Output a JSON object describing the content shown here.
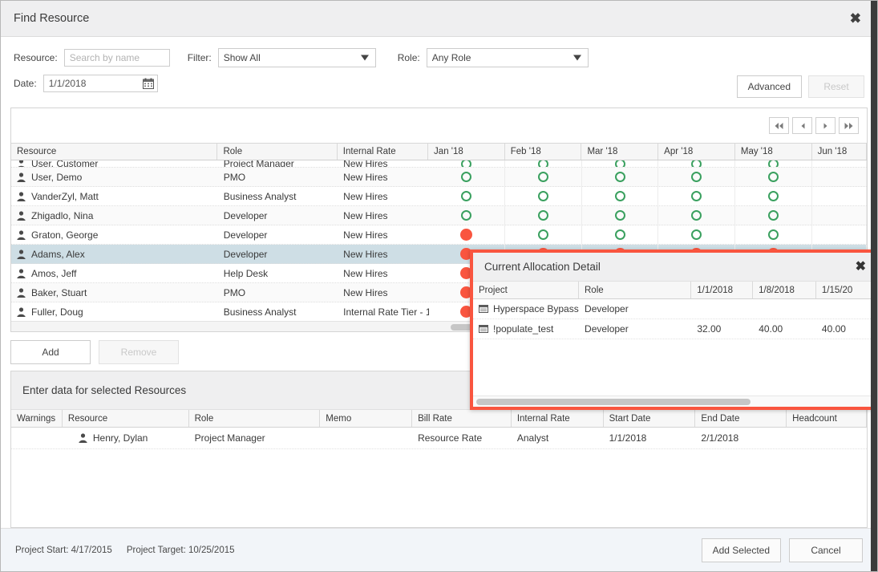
{
  "window": {
    "title": "Find Resource",
    "close_label": "✖"
  },
  "filters": {
    "resource_label": "Resource:",
    "resource_value": "",
    "resource_placeholder": "Search by name",
    "filter_label": "Filter:",
    "filter_value": "Show All",
    "role_label": "Role:",
    "role_value": "Any Role",
    "date_label": "Date:",
    "date_value": "1/1/2018",
    "calendar_icon": "calendar-icon",
    "advanced_label": "Advanced",
    "reset_label": "Reset"
  },
  "grid": {
    "nav": [
      {
        "name": "first-page",
        "glyph": "◀◀"
      },
      {
        "name": "prev-page",
        "glyph": "◀"
      },
      {
        "name": "next-page",
        "glyph": "▶"
      },
      {
        "name": "last-page",
        "glyph": "▶▶"
      }
    ],
    "columns": [
      "Resource",
      "Role",
      "Internal Rate"
    ],
    "month_columns": [
      "Jan '18",
      "Feb '18",
      "Mar '18",
      "Apr '18",
      "May '18",
      "Jun '18"
    ],
    "rows": [
      {
        "resource": "User, Customer",
        "role": "Project Manager",
        "rate": "New Hires",
        "marks": [
          "open",
          "open",
          "open",
          "open",
          "open"
        ],
        "clipped": true,
        "selected": false
      },
      {
        "resource": "User, Demo",
        "role": "PMO",
        "rate": "New Hires",
        "marks": [
          "open",
          "open",
          "open",
          "open",
          "open"
        ],
        "clipped": false,
        "selected": false
      },
      {
        "resource": "VanderZyl, Matt",
        "role": "Business Analyst",
        "rate": "New Hires",
        "marks": [
          "open",
          "open",
          "open",
          "open",
          "open"
        ],
        "clipped": false,
        "selected": false
      },
      {
        "resource": "Zhigadlo, Nina",
        "role": "Developer",
        "rate": "New Hires",
        "marks": [
          "open",
          "open",
          "open",
          "open",
          "open"
        ],
        "clipped": false,
        "selected": false
      },
      {
        "resource": "Graton, George",
        "role": "Developer",
        "rate": "New Hires",
        "marks": [
          "full",
          "open",
          "open",
          "open",
          "open"
        ],
        "clipped": false,
        "selected": false
      },
      {
        "resource": "Adams, Alex",
        "role": "Developer",
        "rate": "New Hires",
        "marks": [
          "full",
          "full",
          "full",
          "full",
          "full"
        ],
        "clipped": false,
        "selected": true
      },
      {
        "resource": "Amos, Jeff",
        "role": "Help Desk",
        "rate": "New Hires",
        "marks": [
          "full",
          "",
          "",
          "",
          ""
        ],
        "clipped": false,
        "selected": false
      },
      {
        "resource": "Baker, Stuart",
        "role": "PMO",
        "rate": "New Hires",
        "marks": [
          "full",
          "",
          "",
          "",
          ""
        ],
        "clipped": false,
        "selected": false
      },
      {
        "resource": "Fuller, Doug",
        "role": "Business Analyst",
        "rate": "Internal Rate Tier - 1",
        "marks": [
          "full",
          "",
          "",
          "",
          ""
        ],
        "clipped": false,
        "selected": false
      }
    ]
  },
  "actions": {
    "add_label": "Add",
    "remove_label": "Remove"
  },
  "entry": {
    "title": "Enter data for selected Resources",
    "columns": [
      "Warnings",
      "Resource",
      "Role",
      "Memo",
      "Bill Rate",
      "Internal Rate",
      "Start Date",
      "End Date",
      "Headcount"
    ],
    "rows": [
      {
        "warnings": "",
        "resource": "Henry, Dylan",
        "role": "Project Manager",
        "memo": "",
        "bill_rate": "Resource Rate",
        "internal_rate": "Analyst",
        "start_date": "1/1/2018",
        "end_date": "2/1/2018",
        "headcount": ""
      }
    ]
  },
  "popup": {
    "title": "Current Allocation Detail",
    "close_label": "✖",
    "columns": [
      "Project",
      "Role",
      "1/1/2018",
      "1/8/2018",
      "1/15/20"
    ],
    "rows": [
      {
        "project": "Hyperspace Bypass",
        "role": "Developer",
        "v1": "",
        "v2": "",
        "v3": ""
      },
      {
        "project": "!populate_test",
        "role": "Developer",
        "v1": "32.00",
        "v2": "40.00",
        "v3": "40.00"
      }
    ]
  },
  "footer": {
    "project_start": "Project Start: 4/17/2015",
    "project_target": "Project Target: 10/25/2015",
    "add_selected_label": "Add Selected",
    "cancel_label": "Cancel"
  },
  "colors": {
    "accent_red": "#f9553f",
    "accent_green": "#3aa05f",
    "selected_row": "#cedee5",
    "header_bg": "#efeff0"
  }
}
